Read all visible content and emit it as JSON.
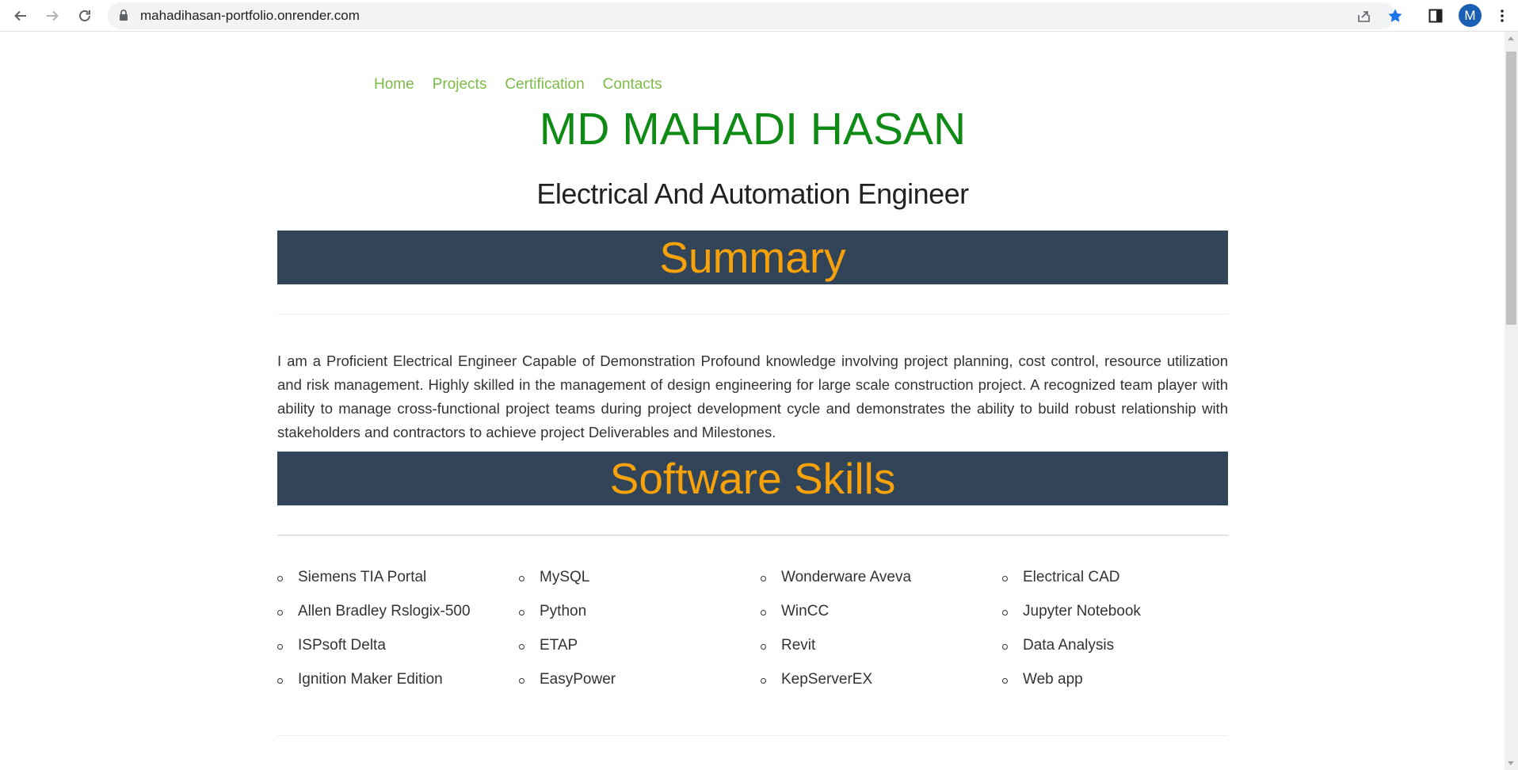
{
  "browser": {
    "url": "mahadihasan-portfolio.onrender.com",
    "profile_initial": "M",
    "star_color": "#1a73e8"
  },
  "nav": {
    "items": [
      "Home",
      "Projects",
      "Certification",
      "Contacts"
    ],
    "color": "#7cbb45"
  },
  "header": {
    "name": "MD MAHADI HASAN",
    "role": "Electrical And Automation Engineer"
  },
  "summary": {
    "heading": "Summary",
    "text": "I am a Proficient Electrical Engineer Capable of Demonstration Profound knowledge involving project planning, cost control, resource utilization and risk management. Highly skilled in the management of design engineering for large scale construction project. A recognized team player with ability to manage cross-functional project teams during project development cycle and demonstrates the ability to build robust relationship with stakeholders and contractors to achieve project Deliverables and Milestones."
  },
  "skills": {
    "heading": "Software Skills",
    "columns": [
      [
        "Siemens TIA Portal",
        "Allen Bradley Rslogix-500",
        "ISPsoft Delta",
        "Ignition Maker Edition"
      ],
      [
        "MySQL",
        "Python",
        "ETAP",
        "EasyPower"
      ],
      [
        "Wonderware Aveva",
        "WinCC",
        "Revit",
        "KepServerEX"
      ],
      [
        "Electrical CAD",
        "Jupyter Notebook",
        "Data Analysis",
        "Web app"
      ]
    ]
  },
  "colors": {
    "banner_bg": "#324457",
    "banner_text": "#f7a20a",
    "name": "#0f8a15"
  }
}
